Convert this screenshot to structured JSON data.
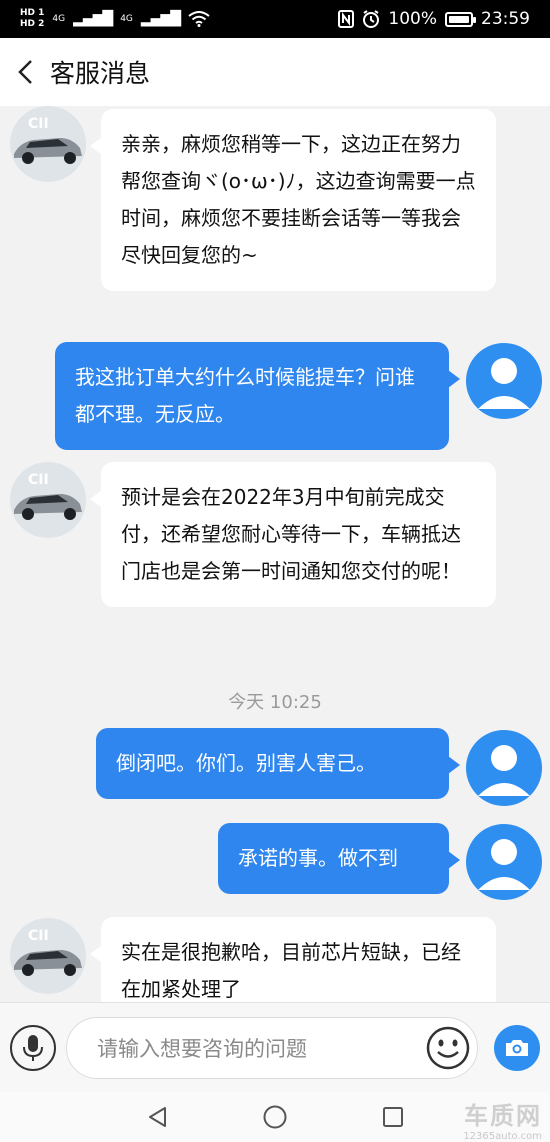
{
  "status_bar": {
    "sim1": "HD 1",
    "sim2": "HD 2",
    "network": "4G",
    "network2": "4G",
    "battery": "100%",
    "battery_level": 1.0,
    "time": "23:59"
  },
  "header": {
    "back_icon": "chevron-left-icon",
    "title": "客服消息"
  },
  "messages": [
    {
      "side": "left",
      "text": "亲亲，麻烦您稍等一下，这边正在努力帮您查询ヾ(o･ω･)ﾉ，这边查询需要一点时间，麻烦您不要挂断会话等一等我会尽快回复您的~"
    },
    {
      "side": "right",
      "text": "我这批订单大约什么时候能提车？问谁都不理。无反应。"
    },
    {
      "side": "left",
      "text": "预计是会在2022年3月中旬前完成交付，还希望您耐心等待一下，车辆抵达门店也是会第一时间通知您交付的呢！"
    },
    {
      "side": "right",
      "text": "倒闭吧。你们。别害人害己。"
    },
    {
      "side": "right",
      "text": "承诺的事。做不到"
    },
    {
      "side": "left",
      "text": "实在是很抱歉哈，目前芯片短缺，已经在加紧处理了"
    }
  ],
  "timestamp": "今天 10:25",
  "input_bar": {
    "placeholder": "请输入想要咨询的问题",
    "mic_icon": "microphone-icon",
    "emoji_icon": "smiley-icon",
    "camera_icon": "camera-icon"
  },
  "nav_bar": {
    "back_icon": "triangle-back-icon",
    "home_icon": "circle-home-icon",
    "recents_icon": "square-recents-icon"
  },
  "watermark": {
    "line1": "车质网",
    "line2": "12365auto.com"
  },
  "colors": {
    "bubble_right": "#2f86ee",
    "bubble_left": "#ffffff",
    "user_avatar": "#2e8ff0",
    "background": "#f2f2f2"
  }
}
